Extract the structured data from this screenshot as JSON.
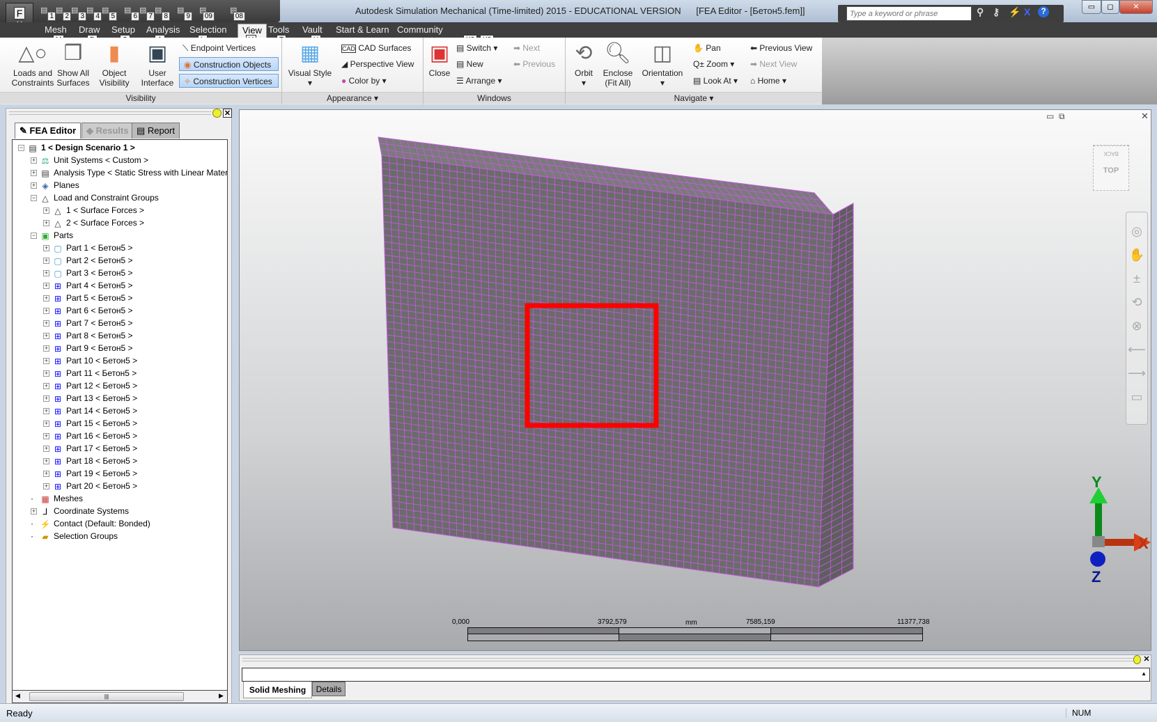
{
  "window": {
    "title": "Autodesk Simulation Mechanical (Time-limited) 2015 - EDUCATIONAL VERSION      [FEA Editor - [Бетон5.fem]]",
    "search_placeholder": "Type a keyword or phrase"
  },
  "app_button": {
    "key": "F",
    "sub": "M"
  },
  "quick_access": [
    "1",
    "2",
    "3",
    "4",
    "5",
    "6",
    "7",
    "8",
    "9",
    "09",
    "08"
  ],
  "menu": [
    {
      "label": "Mesh",
      "key": "M"
    },
    {
      "label": "Draw",
      "key": "D"
    },
    {
      "label": "Setup",
      "key": "S"
    },
    {
      "label": "Analysis",
      "key": "A"
    },
    {
      "label": "Selection",
      "key": "L"
    },
    {
      "label": "View",
      "key": "V",
      "active": true
    },
    {
      "label": "Tools",
      "key": "T"
    },
    {
      "label": "Vault",
      "key": "U"
    },
    {
      "label": "Start & Learn"
    },
    {
      "label": "Community"
    }
  ],
  "menu_extra_keys": [
    "X2",
    "X3"
  ],
  "ribbon": {
    "visibility": {
      "label": "Visibility",
      "loads": "Loads and Constraints",
      "show_all": "Show All Surfaces",
      "object_vis": "Object Visibility",
      "user_if": "User Interface",
      "endpoint": "Endpoint Vertices",
      "constr_obj": "Construction Objects",
      "constr_vert": "Construction Vertices"
    },
    "appearance": {
      "label": "Appearance",
      "visual_style": "Visual Style",
      "cad": "CAD Surfaces",
      "persp": "Perspective View",
      "color_by": "Color by"
    },
    "windows": {
      "label": "Windows",
      "close": "Close",
      "switch": "Switch",
      "new": "New",
      "arrange": "Arrange",
      "next": "Next",
      "previous": "Previous"
    },
    "navigate": {
      "label": "Navigate",
      "orbit": "Orbit",
      "enclose": "Enclose (Fit All)",
      "orientation": "Orientation",
      "pan": "Pan",
      "zoom": "Zoom",
      "look_at": "Look At",
      "prev_view": "Previous View",
      "next_view": "Next View",
      "home": "Home"
    }
  },
  "left_panel": {
    "tabs": [
      "FEA Editor",
      "Results",
      "Report"
    ],
    "tree": [
      {
        "label": "1 < Design Scenario 1 >",
        "level": 0,
        "pm": "-",
        "bold": true,
        "icon": "scenario"
      },
      {
        "label": "Unit Systems < Custom >",
        "level": 1,
        "pm": "+",
        "icon": "units"
      },
      {
        "label": "Analysis Type < Static Stress with Linear Mater",
        "level": 1,
        "pm": "+",
        "icon": "analysis"
      },
      {
        "label": "Planes",
        "level": 1,
        "pm": "+",
        "icon": "planes"
      },
      {
        "label": "Load and Constraint Groups",
        "level": 1,
        "pm": "-",
        "icon": "loads"
      },
      {
        "label": "1 < Surface Forces >",
        "level": 2,
        "pm": "+",
        "icon": "loads"
      },
      {
        "label": "2 < Surface Forces >",
        "level": 2,
        "pm": "+",
        "icon": "loads"
      },
      {
        "label": "Parts",
        "level": 1,
        "pm": "-",
        "icon": "parts"
      },
      {
        "label": "Part 1 < Бетон5 >",
        "level": 2,
        "pm": "+",
        "icon": "part"
      },
      {
        "label": "Part 2 < Бетон5 >",
        "level": 2,
        "pm": "+",
        "icon": "part"
      },
      {
        "label": "Part 3 < Бетон5 >",
        "level": 2,
        "pm": "+",
        "icon": "part"
      },
      {
        "label": "Part 4 < Бетон5 >",
        "level": 2,
        "pm": "+",
        "icon": "meshpart"
      },
      {
        "label": "Part 5 < Бетон5 >",
        "level": 2,
        "pm": "+",
        "icon": "meshpart"
      },
      {
        "label": "Part 6 < Бетон5 >",
        "level": 2,
        "pm": "+",
        "icon": "meshpart"
      },
      {
        "label": "Part 7 < Бетон5 >",
        "level": 2,
        "pm": "+",
        "icon": "meshpart"
      },
      {
        "label": "Part 8 < Бетон5 >",
        "level": 2,
        "pm": "+",
        "icon": "meshpart"
      },
      {
        "label": "Part 9 < Бетон5 >",
        "level": 2,
        "pm": "+",
        "icon": "meshpart"
      },
      {
        "label": "Part 10 < Бетон5 >",
        "level": 2,
        "pm": "+",
        "icon": "meshpart"
      },
      {
        "label": "Part 11 < Бетон5 >",
        "level": 2,
        "pm": "+",
        "icon": "meshpart"
      },
      {
        "label": "Part 12 < Бетон5 >",
        "level": 2,
        "pm": "+",
        "icon": "meshpart"
      },
      {
        "label": "Part 13 < Бетон5 >",
        "level": 2,
        "pm": "+",
        "icon": "meshpart"
      },
      {
        "label": "Part 14 < Бетон5 >",
        "level": 2,
        "pm": "+",
        "icon": "meshpart"
      },
      {
        "label": "Part 15 < Бетон5 >",
        "level": 2,
        "pm": "+",
        "icon": "meshpart"
      },
      {
        "label": "Part 16 < Бетон5 >",
        "level": 2,
        "pm": "+",
        "icon": "meshpart"
      },
      {
        "label": "Part 17 < Бетон5 >",
        "level": 2,
        "pm": "+",
        "icon": "meshpart"
      },
      {
        "label": "Part 18 < Бетон5 >",
        "level": 2,
        "pm": "+",
        "icon": "meshpart"
      },
      {
        "label": "Part 19 < Бетон5 >",
        "level": 2,
        "pm": "+",
        "icon": "meshpart"
      },
      {
        "label": "Part 20 < Бетон5 >",
        "level": 2,
        "pm": "+",
        "icon": "meshpart"
      },
      {
        "label": "Meshes",
        "level": 1,
        "pm": "",
        "icon": "meshes"
      },
      {
        "label": "Coordinate Systems",
        "level": 1,
        "pm": "+",
        "icon": "coords"
      },
      {
        "label": "Contact (Default: Bonded)",
        "level": 1,
        "pm": "",
        "icon": "contact"
      },
      {
        "label": "Selection Groups",
        "level": 1,
        "pm": "",
        "icon": "folder"
      }
    ]
  },
  "viewport": {
    "viewcube": {
      "top": "TOP",
      "back": "BACK"
    },
    "triad": {
      "x": "X",
      "y": "Y",
      "z": "Z"
    },
    "scale_bar": {
      "labels": [
        "0,000",
        "3792,579",
        "7585,159",
        "11377,738"
      ],
      "unit": "mm"
    },
    "colors": {
      "mesh": "#c85ae6",
      "mesh_face": "#6b6b6b",
      "highlight": "#ff0000"
    }
  },
  "bottom_panel": {
    "tabs": [
      "Solid Meshing",
      "Details"
    ]
  },
  "status": {
    "left": "Ready",
    "num": "NUM"
  }
}
